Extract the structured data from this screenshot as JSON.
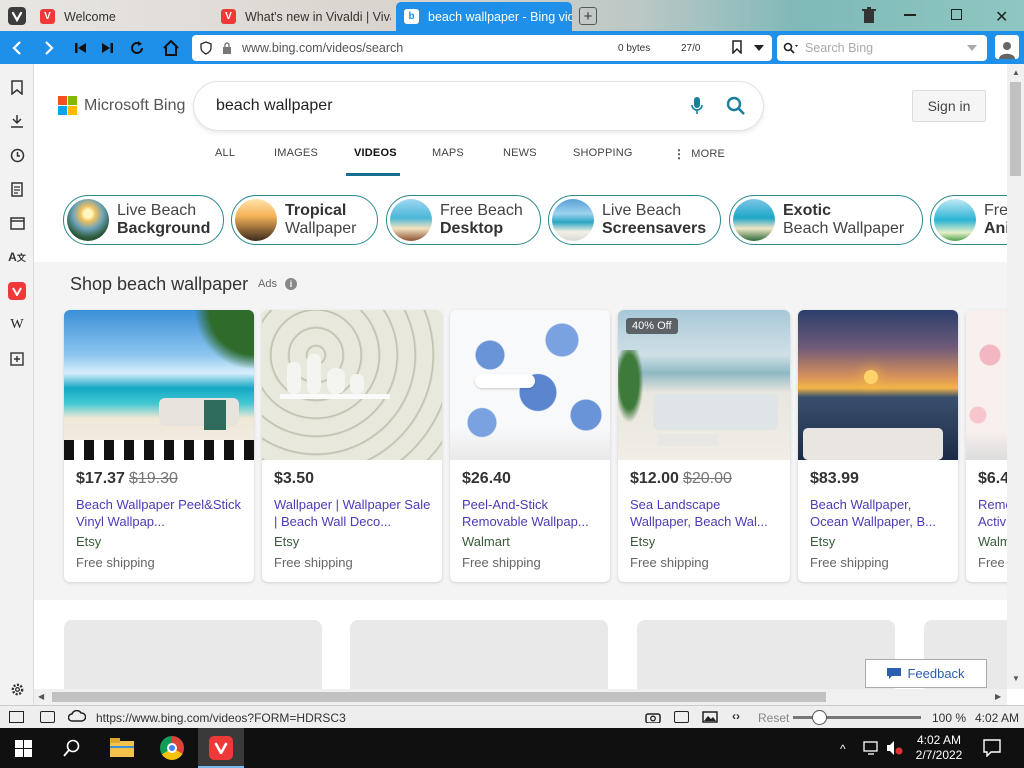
{
  "tabs": [
    {
      "title": "Welcome"
    },
    {
      "title": "What's new in Vivaldi | Viva"
    },
    {
      "title": "beach wallpaper - Bing vide"
    }
  ],
  "address": {
    "url": "www.bing.com/videos/search",
    "bytes": "0 bytes",
    "counter": "27/0",
    "search_placeholder": "Search Bing"
  },
  "bing": {
    "logo_text": "Microsoft Bing",
    "query": "beach wallpaper",
    "signin": "Sign in",
    "nav": [
      "ALL",
      "IMAGES",
      "VIDEOS",
      "MAPS",
      "NEWS",
      "SHOPPING",
      "MORE"
    ],
    "selected_nav": "VIDEOS",
    "pills": [
      {
        "line1": "Live Beach",
        "line2": "Background",
        "bold": "line2"
      },
      {
        "line1": "Tropical",
        "line2": "Wallpaper",
        "bold": "line1"
      },
      {
        "line1": "Free Beach",
        "line2": "Desktop",
        "bold": "line2"
      },
      {
        "line1": "Live Beach",
        "line2": "Screensavers",
        "bold": "line2"
      },
      {
        "line1": "Exotic",
        "line2": "Beach Wallpaper",
        "bold": "line1"
      },
      {
        "line1": "Fre",
        "line2": "Ani",
        "bold": "line2"
      }
    ],
    "shop_title": "Shop beach wallpaper",
    "ads_label": "Ads",
    "products": [
      {
        "price": "$17.37",
        "orig": "$19.30",
        "title": "Beach Wallpaper Peel&Stick Vinyl Wallpap...",
        "store": "Etsy",
        "shipping": "Free shipping",
        "badge": ""
      },
      {
        "price": "$3.50",
        "orig": "",
        "title": "Wallpaper | Wallpaper Sale | Beach Wall Deco...",
        "store": "Etsy",
        "shipping": "Free shipping",
        "badge": ""
      },
      {
        "price": "$26.40",
        "orig": "",
        "title": "Peel-And-Stick Removable Wallpap...",
        "store": "Walmart",
        "shipping": "Free shipping",
        "badge": ""
      },
      {
        "price": "$12.00",
        "orig": "$20.00",
        "title": "Sea Landscape Wallpaper, Beach Wal...",
        "store": "Etsy",
        "shipping": "Free shipping",
        "badge": "40% Off"
      },
      {
        "price": "$83.99",
        "orig": "",
        "title": "Beach Wallpaper, Ocean Wallpaper, B...",
        "store": "Etsy",
        "shipping": "Free shipping",
        "badge": ""
      },
      {
        "price": "$6.4",
        "orig": "",
        "title": "Remo Activ",
        "store": "Walm",
        "shipping": "Free",
        "badge": ""
      }
    ],
    "feedback": "Feedback"
  },
  "status": {
    "url": "https://www.bing.com/videos?FORM=HDRSC3",
    "reset": "Reset",
    "zoom": "100 %",
    "time": "4:02 AM"
  },
  "taskbar": {
    "time": "4:02 AM",
    "date": "2/7/2022"
  },
  "colors": {
    "accent": "#1e90ea",
    "bing_teal": "#2b8a8a",
    "link": "#4b3cb6"
  }
}
